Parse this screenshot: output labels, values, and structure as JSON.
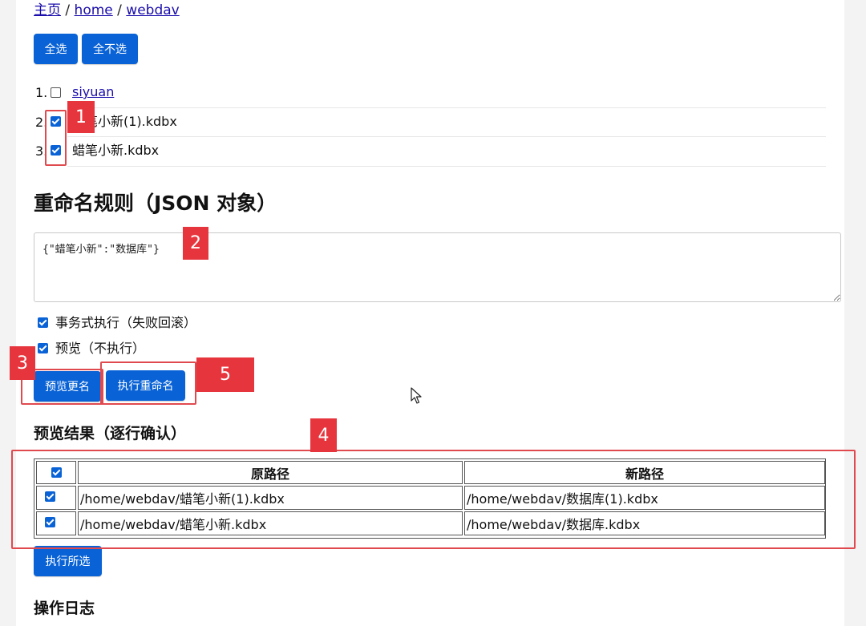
{
  "breadcrumb": {
    "home_zh": "主页",
    "sep": "/",
    "home": "home",
    "webdav": "webdav"
  },
  "toolbar": {
    "select_all": "全选",
    "select_none": "全不选"
  },
  "file_list": [
    {
      "num": "1.",
      "name": "siyuan",
      "checked": false,
      "is_link": true
    },
    {
      "num": "2.",
      "name": "蜡笔小新(1).kdbx",
      "checked": true,
      "is_link": false
    },
    {
      "num": "3.",
      "name": "蜡笔小新.kdbx",
      "checked": true,
      "is_link": false
    }
  ],
  "rename": {
    "heading": "重命名规则（JSON 对象）",
    "rules_value": "{\"蜡笔小新\":\"数据库\"}",
    "transactional_label": "事务式执行（失败回滚）",
    "transactional_checked": true,
    "preview_only_label": "预览（不执行）",
    "preview_only_checked": true,
    "preview_button": "预览更名",
    "execute_button": "执行重命名"
  },
  "preview": {
    "heading": "预览结果（逐行确认）",
    "columns": [
      "原路径",
      "新路径"
    ],
    "rows": [
      {
        "checked": true,
        "old": "/home/webdav/蜡笔小新(1).kdbx",
        "new": "/home/webdav/数据库(1).kdbx"
      },
      {
        "checked": true,
        "old": "/home/webdav/蜡笔小新.kdbx",
        "new": "/home/webdav/数据库.kdbx"
      }
    ],
    "execute_selected": "执行所选"
  },
  "log": {
    "heading": "操作日志"
  },
  "annotations": [
    "1",
    "2",
    "3",
    "4",
    "5"
  ],
  "colors": {
    "accent": "#0a63d6",
    "annotation": "#e7353d",
    "link": "#1a0dab"
  }
}
